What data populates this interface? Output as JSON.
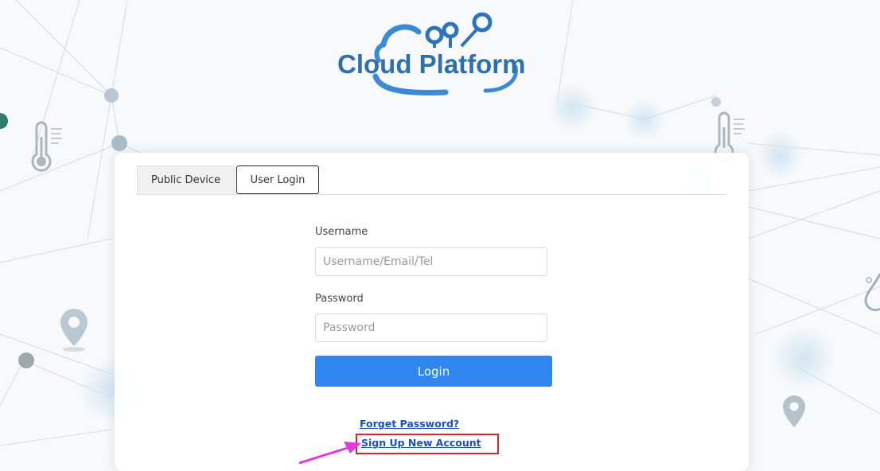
{
  "logo": {
    "text": "Cloud Platform"
  },
  "tabs": [
    {
      "label": "Public Device",
      "active": false
    },
    {
      "label": "User Login",
      "active": true
    }
  ],
  "form": {
    "username_label": "Username",
    "username_placeholder": "Username/Email/Tel",
    "username_value": "",
    "password_label": "Password",
    "password_placeholder": "Password",
    "password_value": "",
    "login_label": "Login"
  },
  "links": {
    "forget_password": "Forget Password?",
    "sign_up": "Sign Up New Account"
  },
  "colors": {
    "primary": "#2f86ef",
    "logo": "#2e6fae",
    "link": "#1a4fc4",
    "highlight_box": "#e0202a",
    "annotation_arrow": "#e23ad8"
  },
  "icons": [
    "cloud-network-logo-icon",
    "thermometer-icon",
    "location-pin-icon",
    "water-drop-icon"
  ]
}
